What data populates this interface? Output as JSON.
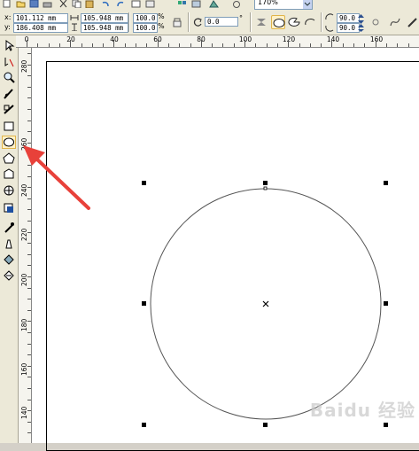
{
  "toolbar": {
    "zoom_value": "170%"
  },
  "property_bar": {
    "x_label": "x:",
    "x_value": "101.112 mm",
    "y_label": "y:",
    "y_value": "186.408 mm",
    "width_value": "105.948 mm",
    "height_value": "105.948 mm",
    "scale_x": "100.0",
    "scale_y": "100.0",
    "percent": "%",
    "rotation_value": "0.0",
    "degree": "°",
    "start_angle": "90.0",
    "end_angle": "90.0"
  },
  "ruler": {
    "horizontal": [
      "0",
      "20",
      "40",
      "60",
      "80",
      "100",
      "120",
      "140",
      "160"
    ],
    "vertical": [
      "280",
      "260",
      "240",
      "220",
      "200",
      "180",
      "160",
      "140"
    ]
  },
  "toolbox": {
    "tools": [
      "pick-tool",
      "shape-tool",
      "zoom-tool",
      "freehand-tool",
      "smart-fill-tool",
      "rectangle-tool",
      "ellipse-tool",
      "polygon-tool",
      "text-tool",
      "table-tool",
      "interactive-tool",
      "eyedropper-tool",
      "outline-tool",
      "fill-tool",
      "interactive-fill-tool"
    ],
    "active": "ellipse-tool"
  },
  "canvas": {
    "shape": "circle",
    "outline_color": "#000000",
    "handle_color": "#000000",
    "annotation_arrow_color": "#e8413a"
  },
  "watermark": "Baidu 经验"
}
